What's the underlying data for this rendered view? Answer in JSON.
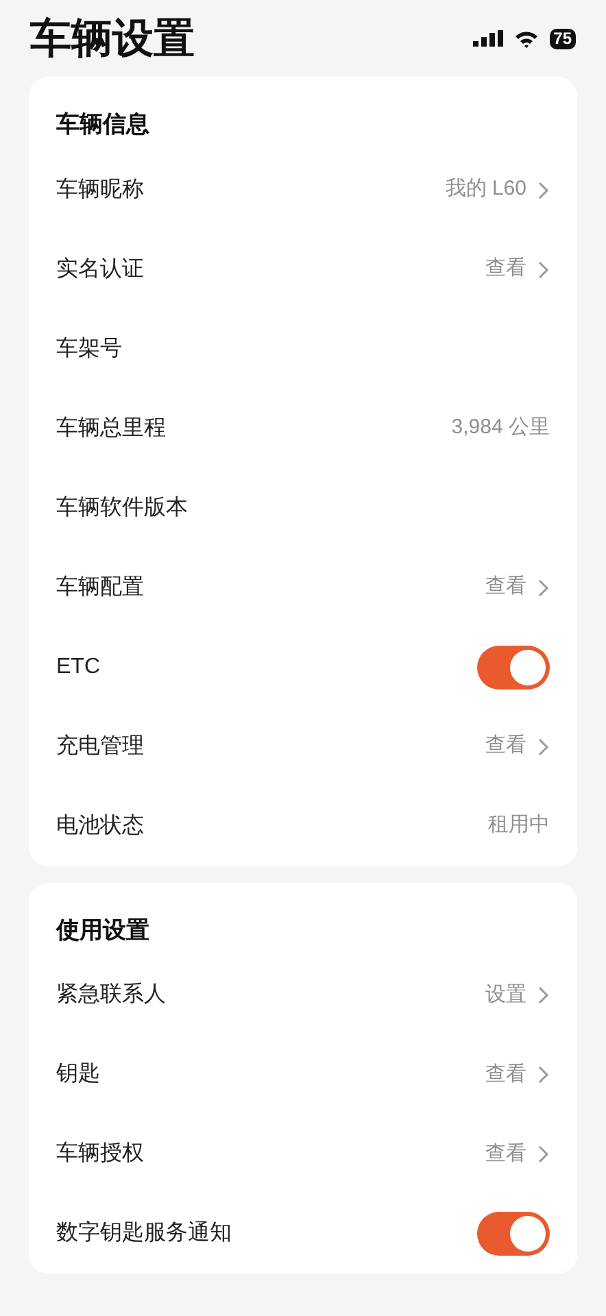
{
  "header": {
    "title": "车辆设置"
  },
  "status_bar": {
    "battery": "75"
  },
  "sections": [
    {
      "title": "车辆信息",
      "rows": [
        {
          "kind": "link",
          "label": "车辆昵称",
          "value": "我的 L60"
        },
        {
          "kind": "link",
          "label": "实名认证",
          "value": "查看"
        },
        {
          "kind": "plain",
          "label": "车架号"
        },
        {
          "kind": "plain",
          "label": "车辆总里程",
          "value": "3,984 公里"
        },
        {
          "kind": "plain",
          "label": "车辆软件版本"
        },
        {
          "kind": "link",
          "label": "车辆配置",
          "value": "查看"
        },
        {
          "kind": "toggle",
          "label": "ETC",
          "on": true
        },
        {
          "kind": "link",
          "label": "充电管理",
          "value": "查看"
        },
        {
          "kind": "plain",
          "label": "电池状态",
          "value": "租用中"
        }
      ]
    },
    {
      "title": "使用设置",
      "rows": [
        {
          "kind": "link",
          "label": "紧急联系人",
          "value": "设置"
        },
        {
          "kind": "link",
          "label": "钥匙",
          "value": "查看"
        },
        {
          "kind": "link",
          "label": "车辆授权",
          "value": "查看"
        },
        {
          "kind": "toggle",
          "label": "数字钥匙服务通知",
          "on": true
        }
      ]
    }
  ]
}
